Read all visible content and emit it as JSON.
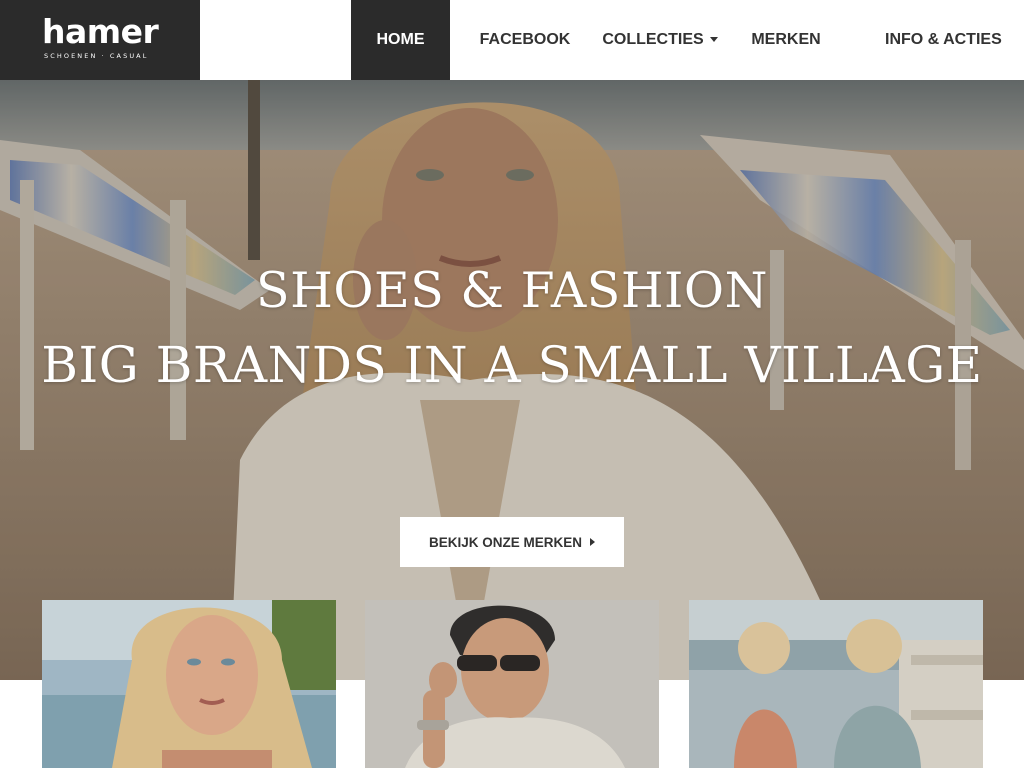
{
  "header": {
    "logo": {
      "wordmark": "hamer",
      "tagline": "SCHOENEN · CASUAL"
    },
    "nav": [
      {
        "label": "HOME",
        "active": true
      },
      {
        "label": "FACEBOOK",
        "active": false
      },
      {
        "label": "COLLECTIES",
        "active": false,
        "has_dropdown": true
      },
      {
        "label": "MERKEN",
        "active": false
      },
      {
        "label": "INFO & ACTIES",
        "active": false
      }
    ]
  },
  "hero": {
    "title_line1": "SHOES & FASHION",
    "title_line2": "BIG BRANDS IN A SMALL VILLAGE",
    "cta_label": "BEKIJK ONZE MERKEN",
    "cta_icon": "caret-right-icon"
  },
  "tiles": [
    {
      "image": "woman-portrait-beach"
    },
    {
      "image": "man-sunglasses"
    },
    {
      "image": "kids-at-beach"
    }
  ],
  "colors": {
    "header_dark": "#2b2b2b",
    "nav_text": "#333333",
    "white": "#ffffff"
  }
}
